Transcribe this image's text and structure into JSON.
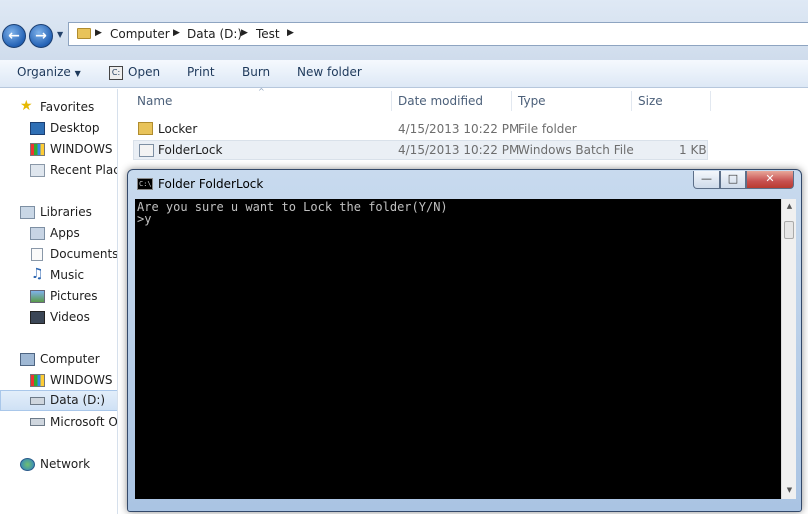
{
  "address": {
    "crumbs": [
      "Computer",
      "Data (D:)",
      "Test"
    ]
  },
  "toolbar": {
    "organize": "Organize",
    "open": "Open",
    "print": "Print",
    "burn": "Burn",
    "new_folder": "New folder"
  },
  "nav": {
    "favorites": "Favorites",
    "desktop": "Desktop",
    "windows1": "WINDOWS (C",
    "recent": "Recent Place",
    "libraries": "Libraries",
    "apps": "Apps",
    "documents": "Documents",
    "music": "Music",
    "pictures": "Pictures",
    "videos": "Videos",
    "computer": "Computer",
    "windows2": "WINDOWS (C",
    "data": "Data (D:)",
    "microsoft": "Microsoft Of",
    "network": "Network"
  },
  "columns": {
    "name": "Name",
    "date": "Date modified",
    "type": "Type",
    "size": "Size"
  },
  "files": [
    {
      "name": "Locker",
      "date": "4/15/2013 10:22 PM",
      "type": "File folder",
      "size": ""
    },
    {
      "name": "FolderLock",
      "date": "4/15/2013 10:22 PM",
      "type": "Windows Batch File",
      "size": "1 KB"
    }
  ],
  "console": {
    "title": "Folder FolderLock",
    "icon_text": "C:\\",
    "line1": "Are you sure u want to Lock the folder(Y/N)",
    "line2": ">y"
  },
  "colors": {
    "console_bg": "#000000",
    "console_text": "#c0c0c0",
    "close_button": "#c75050"
  }
}
